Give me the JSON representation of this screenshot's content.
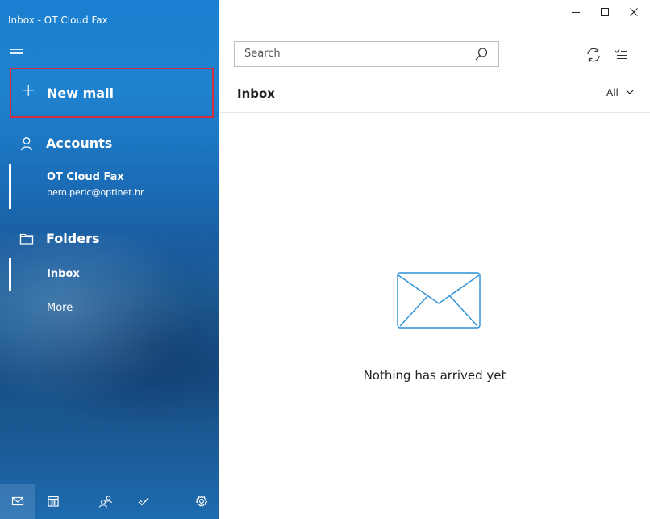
{
  "window": {
    "title": "Inbox - OT Cloud Fax"
  },
  "sidebar": {
    "new_mail_label": "New mail",
    "accounts_label": "Accounts",
    "account": {
      "name": "OT Cloud Fax",
      "email": "pero.peric@optinet.hr"
    },
    "folders_label": "Folders",
    "folders": [
      {
        "label": "Inbox",
        "selected": true
      },
      {
        "label": "More",
        "selected": false
      }
    ],
    "bottom_nav": [
      "mail-icon",
      "calendar-icon",
      "people-icon",
      "todo-icon",
      "settings-icon"
    ]
  },
  "main": {
    "search_placeholder": "Search",
    "list_title": "Inbox",
    "filter_label": "All",
    "empty_message": "Nothing has arrived yet"
  },
  "colors": {
    "sidebar_blue": "#1b6db7",
    "highlight_red": "#d32f3a",
    "envelope_blue": "#2b8fd6"
  }
}
